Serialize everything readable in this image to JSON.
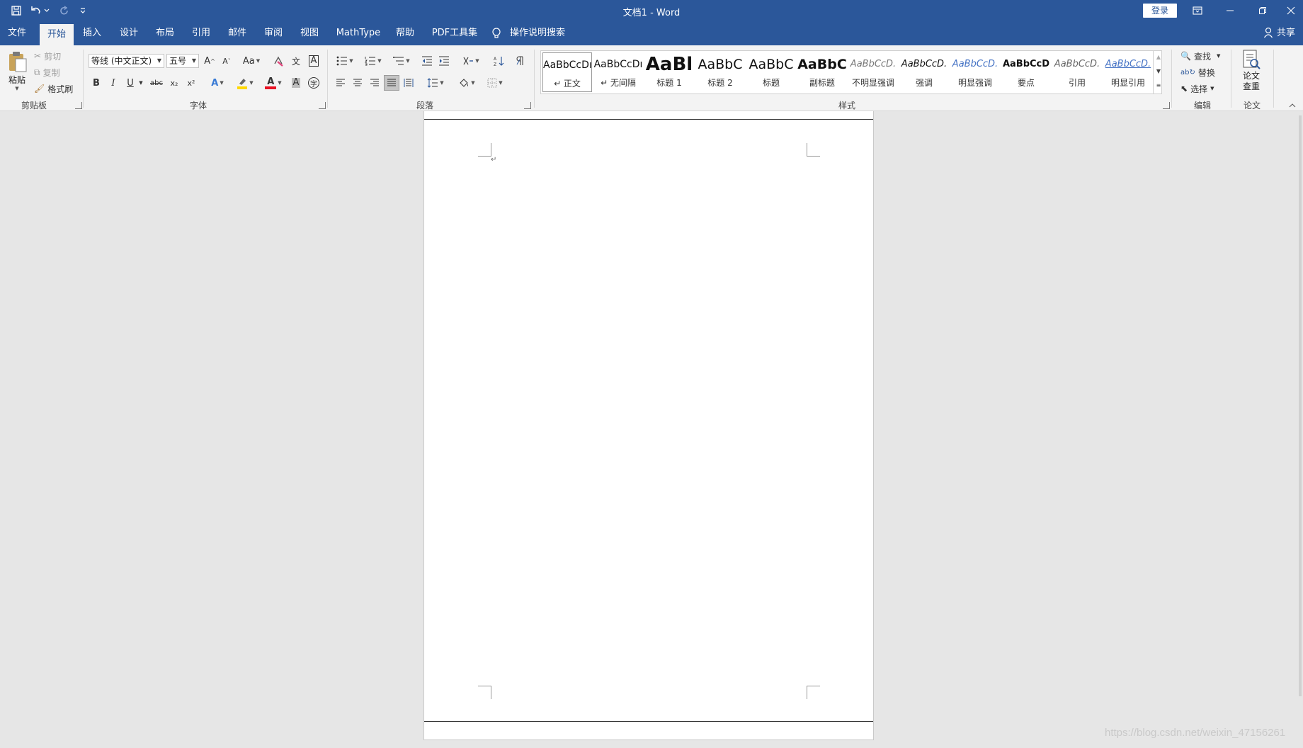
{
  "window": {
    "title": "文档1  -  Word",
    "login_label": "登录",
    "share_label": "共享"
  },
  "tabs": [
    {
      "label": "文件"
    },
    {
      "label": "开始",
      "active": true
    },
    {
      "label": "插入"
    },
    {
      "label": "设计"
    },
    {
      "label": "布局"
    },
    {
      "label": "引用"
    },
    {
      "label": "邮件"
    },
    {
      "label": "审阅"
    },
    {
      "label": "视图"
    },
    {
      "label": "MathType"
    },
    {
      "label": "帮助"
    },
    {
      "label": "PDF工具集"
    },
    {
      "label": "操作说明搜索"
    }
  ],
  "clipboard": {
    "group_label": "剪贴板",
    "paste_label": "粘贴",
    "cut_label": "剪切",
    "copy_label": "复制",
    "format_painter_label": "格式刷"
  },
  "font": {
    "group_label": "字体",
    "font_name": "等线 (中文正文)",
    "font_size": "五号",
    "change_case_label": "Aa",
    "bold": "B",
    "italic": "I",
    "underline": "U",
    "strike": "abc",
    "subscript": "x₂",
    "superscript": "x²",
    "text_effect": "A",
    "font_color": "A",
    "shading": "A",
    "enclose": "字",
    "phonetic": "文",
    "char_border": "A",
    "grow": "A",
    "shrink": "A"
  },
  "paragraph": {
    "group_label": "段落"
  },
  "styles": {
    "group_label": "样式",
    "items": [
      {
        "sample": "AaBbCcDı",
        "name": "↵ 正文",
        "selected": true
      },
      {
        "sample": "AaBbCcDı",
        "name": "↵ 无间隔"
      },
      {
        "sample": "AaBl",
        "name": "标题 1"
      },
      {
        "sample": "AaBbC",
        "name": "标题 2"
      },
      {
        "sample": "AaBbC",
        "name": "标题"
      },
      {
        "sample": "AaBbC",
        "name": "副标题"
      },
      {
        "sample": "AaBbCcD.",
        "name": "不明显强调"
      },
      {
        "sample": "AaBbCcD.",
        "name": "强调"
      },
      {
        "sample": "AaBbCcD.",
        "name": "明显强调"
      },
      {
        "sample": "AaBbCcD",
        "name": "要点"
      },
      {
        "sample": "AaBbCcD.",
        "name": "引用"
      },
      {
        "sample": "AaBbCcD.",
        "name": "明显引用"
      }
    ]
  },
  "editing": {
    "group_label": "编辑",
    "find_label": "查找",
    "replace_label": "替换",
    "select_label": "选择"
  },
  "paper": {
    "group_label": "论文",
    "check_label_line1": "论文",
    "check_label_line2": "查重"
  },
  "document": {
    "paragraph_mark": "↵"
  },
  "watermark": "https://blog.csdn.net/weixin_47156261",
  "colors": {
    "title_bar": "#2b579a",
    "ribbon": "#f3f3f3",
    "doc_background": "#e6e6e6",
    "highlight_yellow": "#ffd800",
    "font_red": "#e81123"
  }
}
